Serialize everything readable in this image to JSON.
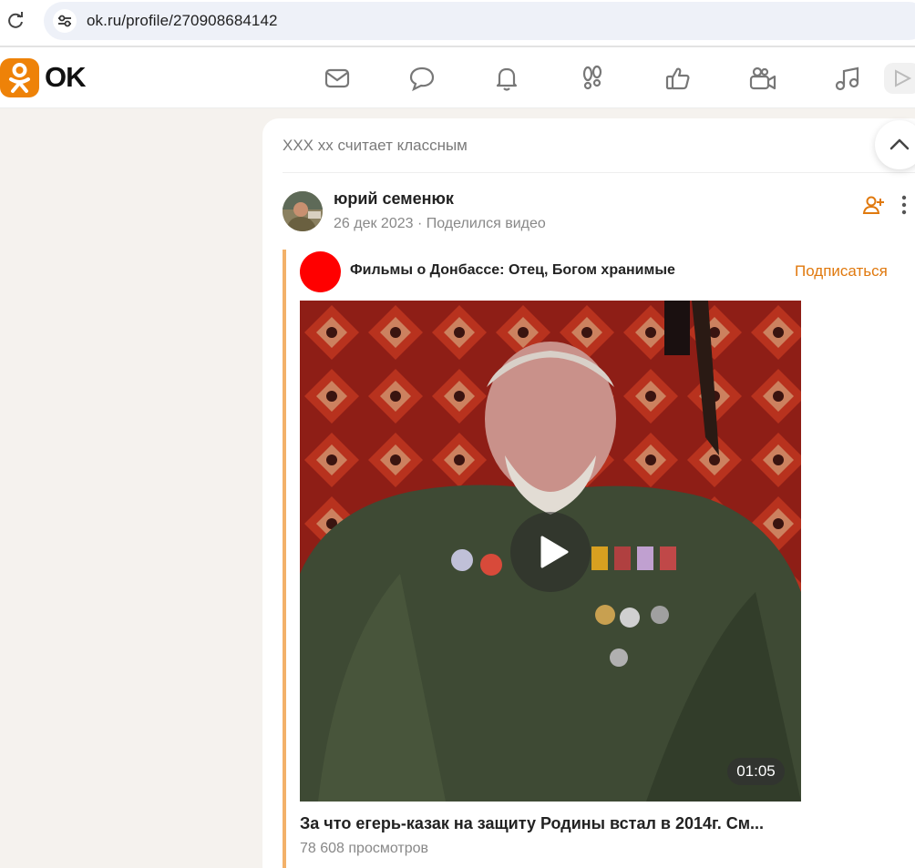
{
  "browser": {
    "url": "ok.ru/profile/270908684142"
  },
  "header": {
    "logo_text": "OK",
    "nav_icons": [
      "mail-icon",
      "chat-icon",
      "bell-icon",
      "footprints-icon",
      "thumbs-up-icon",
      "video-camera-icon",
      "music-note-icon"
    ]
  },
  "feed": {
    "liked_by": "XXX xx считает классным",
    "post": {
      "author": "юрий семенюк",
      "date": "26 дек 2023",
      "separator": "·",
      "action": "Поделился видео"
    },
    "repost": {
      "group_name": "Фильмы о Донбассе: Отец, Богом хранимые",
      "subscribe_label": "Подписаться",
      "video": {
        "duration": "01:05",
        "title": "За что егерь-казак на защиту Родины встал в 2014г. См...",
        "views": "78 608 просмотров"
      }
    }
  },
  "colors": {
    "accent": "#ee8208",
    "subscribe": "#e0790e",
    "repost_border": "#f3b169",
    "group_avatar": "#ff0000"
  }
}
